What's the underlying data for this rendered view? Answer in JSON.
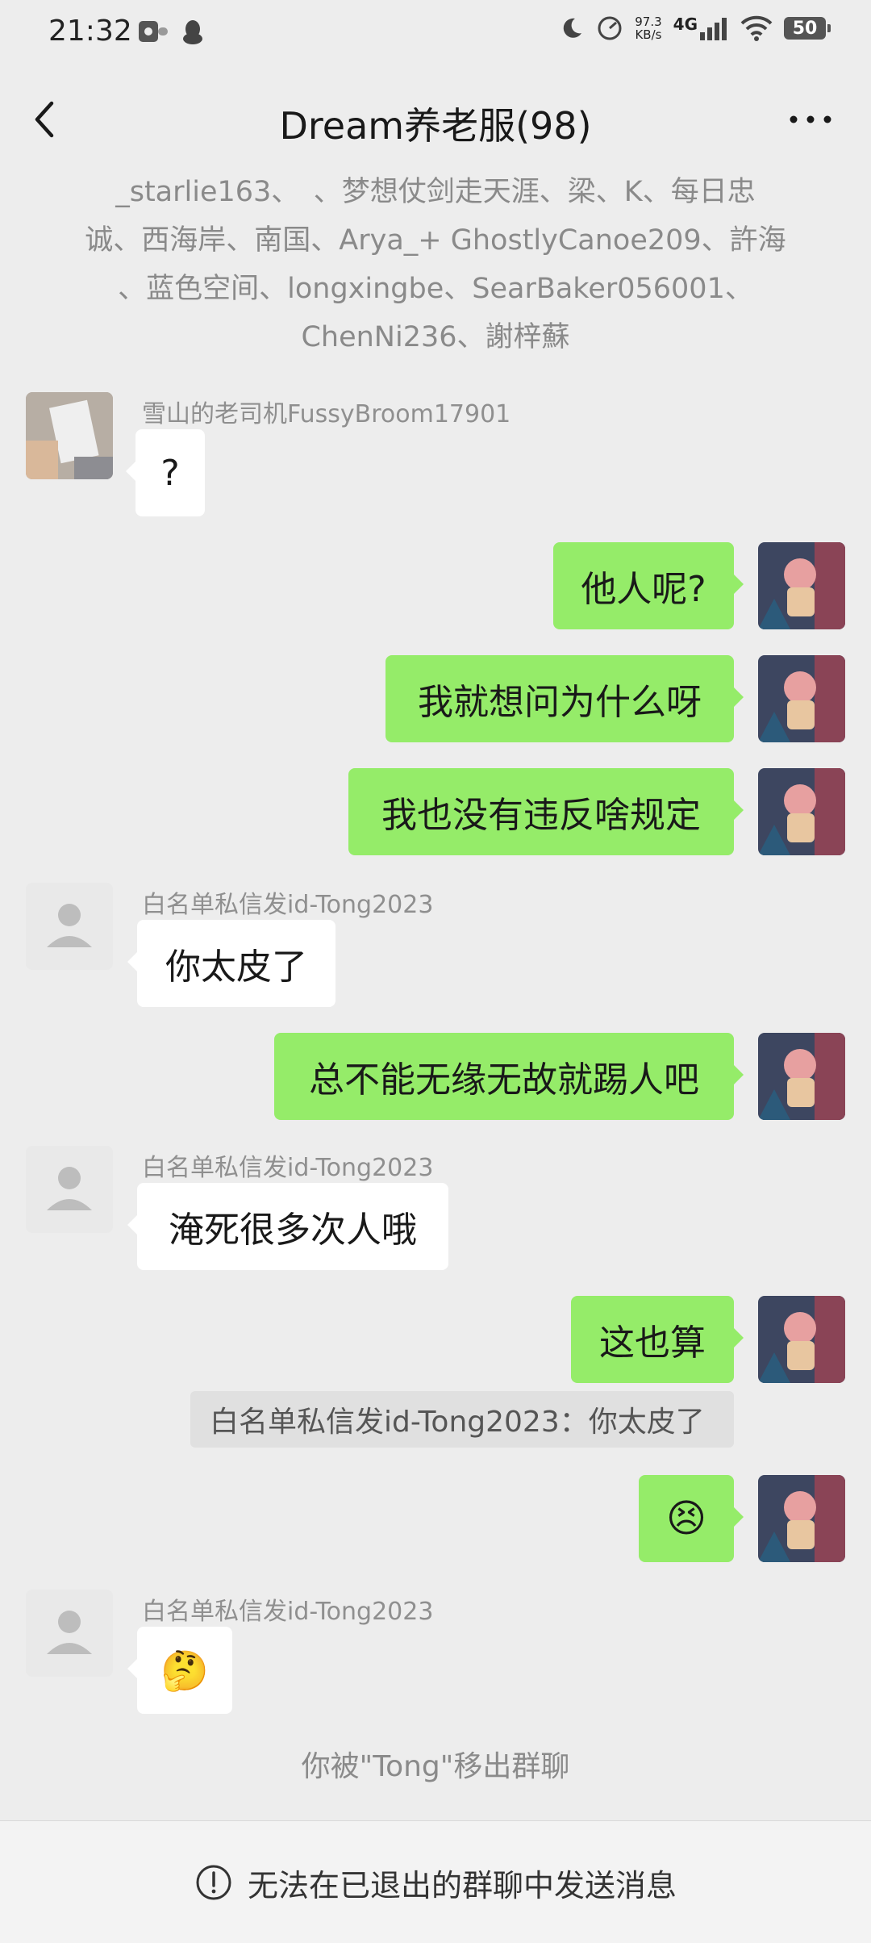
{
  "status_bar": {
    "time": "21:32",
    "speed_value": "97.3",
    "speed_unit": "KB/s",
    "network": "4G",
    "battery": "50"
  },
  "header": {
    "title": "Dream养老服(98)"
  },
  "members_lines": [
    "_starlie163、　、梦想仗剑走天涯、梁、K、每日忠",
    "诚、西海岸、南国、Arya_+ GhostlyCanoe209、許海",
    "、蓝色空间、longxingbe、SearBaker056001、",
    "ChenNi236、謝梓蘇"
  ],
  "messages": [
    {
      "sender": "雪山的老司机FussyBroom17901",
      "text": "?"
    },
    {
      "text": "他人呢?"
    },
    {
      "text": "我就想问为什么呀"
    },
    {
      "text": "我也没有违反啥规定"
    },
    {
      "sender": "白名单私信发id-Tong2023",
      "text": "你太皮了"
    },
    {
      "text": "总不能无缘无故就踢人吧"
    },
    {
      "sender": "白名单私信发id-Tong2023",
      "text": "淹死很多次人哦"
    },
    {
      "text": "这也算"
    },
    {
      "quote": "白名单私信发id-Tong2023：你太皮了"
    },
    {
      "emoji": "😣"
    },
    {
      "sender": "白名单私信发id-Tong2023",
      "emoji": "🤔"
    }
  ],
  "system_message": "你被\"Tong\"移出群聊",
  "bottom_bar": {
    "text": "无法在已退出的群聊中发送消息"
  },
  "icons": {
    "back": "back-arrow-icon",
    "more": "more-dots-icon",
    "info": "info-circle-icon"
  },
  "colors": {
    "outgoing_bubble": "#95ec69",
    "incoming_bubble": "#ffffff",
    "background": "#ededed"
  }
}
